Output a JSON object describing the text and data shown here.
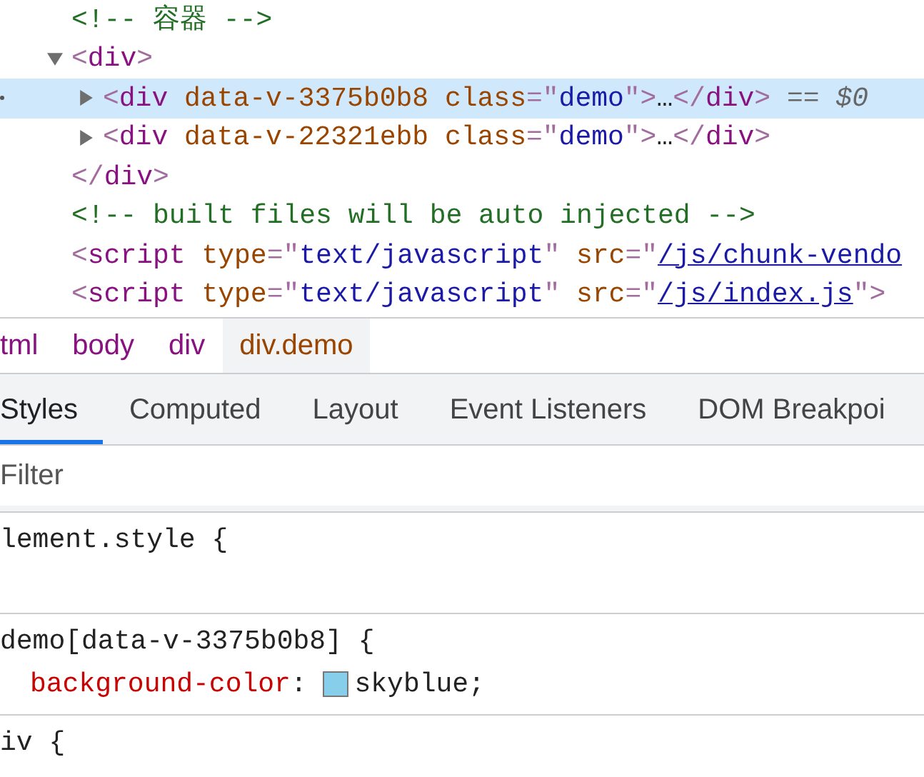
{
  "dom_tree": [
    {
      "tokens": [
        {
          "kind": "comment",
          "text": "<!-- 容器 -->"
        }
      ],
      "selected": false
    },
    {
      "tokens": [
        {
          "kind": "punct",
          "text": "<"
        },
        {
          "kind": "tag",
          "text": "div"
        },
        {
          "kind": "punct",
          "text": ">"
        }
      ],
      "expanded": true,
      "selected": false,
      "closing": [
        {
          "kind": "punct",
          "text": "</"
        },
        {
          "kind": "tag",
          "text": "div"
        },
        {
          "kind": "punct",
          "text": ">"
        }
      ],
      "children": [
        {
          "tokens": [
            {
              "kind": "punct",
              "text": "<"
            },
            {
              "kind": "tag",
              "text": "div"
            },
            {
              "kind": "attr",
              "text": " data-v-3375b0b8"
            },
            {
              "kind": "attr",
              "text": " class"
            },
            {
              "kind": "punct",
              "text": "=\""
            },
            {
              "kind": "value",
              "text": "demo"
            },
            {
              "kind": "punct",
              "text": "\">"
            },
            {
              "kind": "text",
              "text": "…"
            },
            {
              "kind": "punct",
              "text": "</"
            },
            {
              "kind": "tag",
              "text": "div"
            },
            {
              "kind": "punct",
              "text": ">"
            },
            {
              "kind": "ref",
              "text": " == $0"
            }
          ],
          "expanded": false,
          "selected": true
        },
        {
          "tokens": [
            {
              "kind": "punct",
              "text": "<"
            },
            {
              "kind": "tag",
              "text": "div"
            },
            {
              "kind": "attr",
              "text": " data-v-22321ebb"
            },
            {
              "kind": "attr",
              "text": " class"
            },
            {
              "kind": "punct",
              "text": "=\""
            },
            {
              "kind": "value",
              "text": "demo"
            },
            {
              "kind": "punct",
              "text": "\">"
            },
            {
              "kind": "text",
              "text": "…"
            },
            {
              "kind": "punct",
              "text": "</"
            },
            {
              "kind": "tag",
              "text": "div"
            },
            {
              "kind": "punct",
              "text": ">"
            }
          ],
          "expanded": false,
          "selected": false
        }
      ]
    },
    {
      "tokens": [
        {
          "kind": "comment",
          "text": "<!-- built files will be auto injected -->"
        }
      ],
      "selected": false
    },
    {
      "tokens": [
        {
          "kind": "punct",
          "text": "<"
        },
        {
          "kind": "tag",
          "text": "script"
        },
        {
          "kind": "attr",
          "text": " type"
        },
        {
          "kind": "punct",
          "text": "=\""
        },
        {
          "kind": "value",
          "text": "text/javascript"
        },
        {
          "kind": "punct",
          "text": "\""
        },
        {
          "kind": "attr",
          "text": " src"
        },
        {
          "kind": "punct",
          "text": "=\""
        },
        {
          "kind": "link",
          "text": "/js/chunk-vendo"
        }
      ],
      "selected": false
    },
    {
      "tokens": [
        {
          "kind": "punct",
          "text": "<"
        },
        {
          "kind": "tag",
          "text": "script"
        },
        {
          "kind": "attr",
          "text": " type"
        },
        {
          "kind": "punct",
          "text": "=\""
        },
        {
          "kind": "value",
          "text": "text/javascript"
        },
        {
          "kind": "punct",
          "text": "\""
        },
        {
          "kind": "attr",
          "text": " src"
        },
        {
          "kind": "punct",
          "text": "=\""
        },
        {
          "kind": "link",
          "text": "/js/index.js"
        },
        {
          "kind": "punct",
          "text": "\">"
        }
      ],
      "selected": false
    }
  ],
  "breadcrumbs": [
    {
      "label": "tml",
      "selected": false
    },
    {
      "label": "body",
      "selected": false
    },
    {
      "label": "div",
      "selected": false
    },
    {
      "label": "div.demo",
      "selected": true
    }
  ],
  "tabs": [
    {
      "label": "Styles",
      "selected": true
    },
    {
      "label": "Computed",
      "selected": false
    },
    {
      "label": "Layout",
      "selected": false
    },
    {
      "label": "Event Listeners",
      "selected": false
    },
    {
      "label": "DOM Breakpoi",
      "selected": false
    }
  ],
  "filter": {
    "placeholder": "Filter"
  },
  "rules": [
    {
      "selector": "lement.style {"
    },
    {
      "selector": "demo[data-v-3375b0b8] {",
      "properties": [
        {
          "name": "background-color",
          "separator": ":",
          "value": "skyblue;",
          "color": "#87ceeb"
        }
      ]
    },
    {
      "selector": "iv {"
    }
  ]
}
